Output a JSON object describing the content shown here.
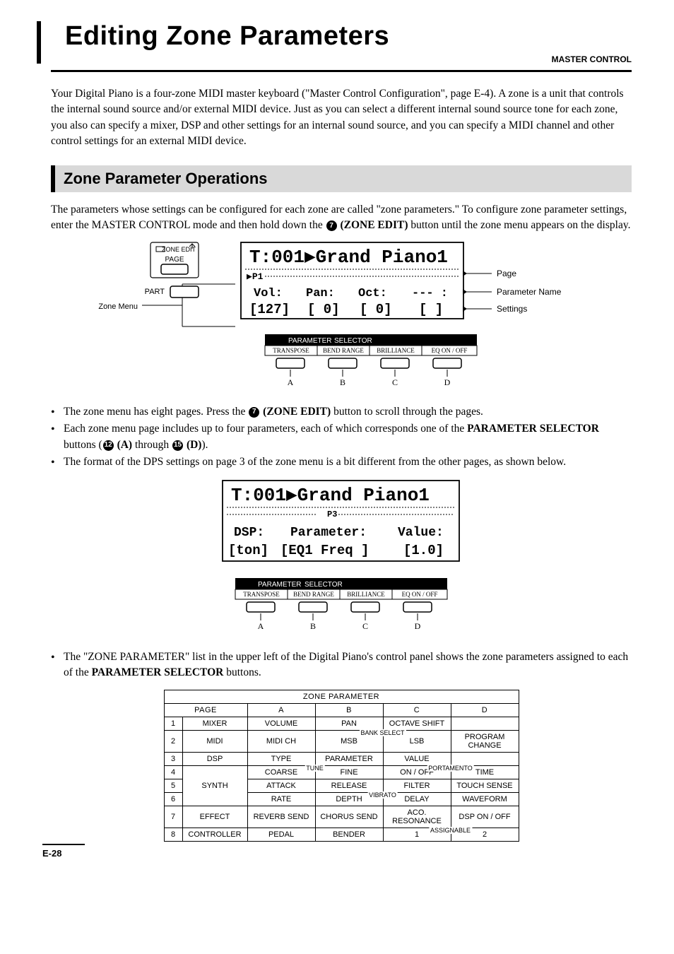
{
  "header": {
    "title": "Editing Zone Parameters",
    "master": "MASTER CONTROL"
  },
  "intro": "Your Digital Piano is a four-zone MIDI master keyboard (\"Master Control Configuration\", page E-4). A zone is a unit that controls the internal sound source and/or external MIDI device. Just as you can select a different internal sound source tone for each zone, you also can specify a mixer, DSP and other settings for an internal sound source, and you can specify a MIDI channel and other control settings for an external MIDI device.",
  "section1": {
    "heading": "Zone Parameter Operations",
    "para1_a": "The parameters whose settings can be configured for each zone are called \"zone parameters.\" To configure zone parameter settings, enter the MASTER CONTROL mode and then hold down the ",
    "para1_b": " (ZONE EDIT)",
    "para1_c": " button until the zone menu appears on the display.",
    "circ7": "7"
  },
  "fig1": {
    "ze_label": "ZONE EDIT",
    "ze_page": "PAGE",
    "part": "PART",
    "zone_menu": "Zone Menu",
    "lcd_top": "T:001▶Grand  Piano1",
    "lcd_row2a": "Vol:",
    "lcd_row2b": "Pan:",
    "lcd_row2c": "Oct:",
    "lcd_row2d": "--- :",
    "lcd_row3a": "[127]",
    "lcd_row3b": "[ 0]",
    "lcd_row3c": "[ 0]",
    "lcd_row3d": "[   ]",
    "page_arrow": "▶P1",
    "param_sel": "PARAMETER SELECTOR",
    "btnA": "TRANSPOSE",
    "btnB": "BEND RANGE",
    "btnC": "BRILLIANCE",
    "btnD": "EQ ON / OFF",
    "A": "A",
    "B": "B",
    "C": "C",
    "D": "D",
    "call_page": "Page",
    "call_param": "Parameter Name",
    "call_set": "Settings"
  },
  "bullets1": {
    "b1a": "The zone menu has eight pages. Press the ",
    "b1b": " (ZONE EDIT)",
    "b1c": " button to scroll through the pages.",
    "circ7": "7",
    "b2a": "Each zone menu page includes up to four parameters, each of which corresponds one of the ",
    "b2b": "PARAMETER SELECTOR",
    "b2c": " buttons (",
    "b2d": " (A)",
    "b2e": " through ",
    "b2f": " (D)",
    "b2g": ").",
    "circ12": "12",
    "circ15": "15",
    "b3": "The format of the DPS settings on page 3 of the zone menu is a bit different from the other pages, as shown below."
  },
  "fig2": {
    "lcd_top": "T:001▶Grand  Piano1",
    "page_arrow": "P3",
    "lcd_row2a": "DSP:",
    "lcd_row2b": "Parameter:",
    "lcd_row2c": "Value:",
    "lcd_row3a": "[ton]",
    "lcd_row3b": "[EQ1 Freq ]",
    "lcd_row3c": "[1.0]",
    "param_sel": "PARAMETER SELECTOR",
    "btnA": "TRANSPOSE",
    "btnB": "BEND RANGE",
    "btnC": "BRILLIANCE",
    "btnD": "EQ ON / OFF",
    "A": "A",
    "B": "B",
    "C": "C",
    "D": "D"
  },
  "bullets2": {
    "b1a": "The \"ZONE PARAMETER\" list in the upper left of the Digital Piano's control panel shows the zone parameters assigned to each of the ",
    "b1b": "PARAMETER SELECTOR",
    "b1c": " buttons."
  },
  "table": {
    "title": "ZONE PARAMETER",
    "page_hdr": "PAGE",
    "cols": {
      "A": "A",
      "B": "B",
      "C": "C",
      "D": "D"
    },
    "rows": [
      {
        "n": "1",
        "name": "MIXER",
        "a": "VOLUME",
        "b": "PAN",
        "c": "OCTAVE SHIFT",
        "d": ""
      },
      {
        "n": "2",
        "name": "MIDI",
        "a": "MIDI CH",
        "b": "MSB",
        "c": "LSB",
        "d": "PROGRAM CHANGE",
        "over_bc": "BANK SELECT"
      },
      {
        "n": "3",
        "name": "DSP",
        "a": "TYPE",
        "b": "PARAMETER",
        "c": "VALUE",
        "d": ""
      },
      {
        "n": "4",
        "name": "",
        "a": "COARSE",
        "b": "FINE",
        "c": "ON / OFF",
        "d": "TIME",
        "over_ab": "TUNE",
        "over_cd": "PORTAMENTO"
      },
      {
        "n": "5",
        "name": "SYNTH",
        "a": "ATTACK",
        "b": "RELEASE",
        "c": "FILTER",
        "d": "TOUCH SENSE"
      },
      {
        "n": "6",
        "name": "",
        "a": "RATE",
        "b": "DEPTH",
        "c": "DELAY",
        "d": "WAVEFORM",
        "over_bc": "VIBRATO"
      },
      {
        "n": "7",
        "name": "EFFECT",
        "a": "REVERB SEND",
        "b": "CHORUS SEND",
        "c": "ACO. RESONANCE",
        "d": "DSP ON / OFF"
      },
      {
        "n": "8",
        "name": "CONTROLLER",
        "a": "PEDAL",
        "b": "BENDER",
        "c": "1",
        "d": "2",
        "over_cd": "ASSIGNABLE"
      }
    ]
  },
  "footer": "E-28"
}
